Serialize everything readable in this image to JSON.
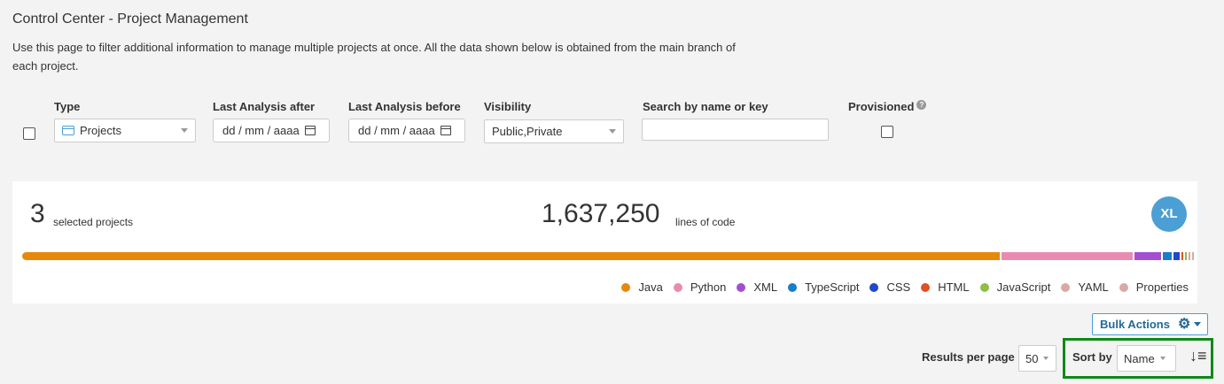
{
  "page": {
    "title": "Control Center - Project Management",
    "description": "Use this page to filter additional information to manage multiple projects at once. All the data shown below is obtained from the main branch of each project."
  },
  "filters": {
    "type": {
      "label": "Type",
      "value": "Projects",
      "icon": "project-icon"
    },
    "analysis_after": {
      "label": "Last Analysis after",
      "placeholder": "dd / mm / aaaa",
      "icon": "calendar-icon"
    },
    "analysis_before": {
      "label": "Last Analysis before",
      "placeholder": "dd / mm / aaaa",
      "icon": "calendar-icon"
    },
    "visibility": {
      "label": "Visibility",
      "value": "Public,Private"
    },
    "search": {
      "label": "Search by name or key",
      "value": ""
    },
    "provisioned": {
      "label": "Provisioned",
      "help_icon": "help-icon",
      "help_glyph": "?"
    }
  },
  "summary": {
    "selected_count": "3",
    "selected_label": "selected projects",
    "lines_count": "1,637,250",
    "lines_label": "lines of code",
    "avatar_initials": "XL",
    "avatar_color": "#4b9fd5"
  },
  "languages": [
    {
      "name": "Java",
      "color": "#e6890a",
      "share": 0.833
    },
    {
      "name": "Python",
      "color": "#e98bb0",
      "share": 0.113
    },
    {
      "name": "XML",
      "color": "#a24fd1",
      "share": 0.024
    },
    {
      "name": "TypeScript",
      "color": "#1a7dc9",
      "share": 0.009
    },
    {
      "name": "CSS",
      "color": "#2247c9",
      "share": 0.007
    },
    {
      "name": "HTML",
      "color": "#e44e25",
      "share": 0.003
    },
    {
      "name": "JavaScript",
      "color": "#8dbf45",
      "share": 0.002
    },
    {
      "name": "YAML",
      "color": "#d9aaa4",
      "share": 0.001
    },
    {
      "name": "Properties",
      "color": "#d9aaa4",
      "share": 0.001
    }
  ],
  "actions": {
    "bulk_label": "Bulk Actions",
    "bulk_icon": "gear-icon",
    "bulk_glyph": "⚙"
  },
  "pagination": {
    "results_label": "Results per page",
    "results_value": "50"
  },
  "sort": {
    "label": "Sort by",
    "value": "Name",
    "direction_icon": "sort-ascending-icon",
    "direction_glyph": "↓≡",
    "highlight_color": "#0c8a15"
  }
}
